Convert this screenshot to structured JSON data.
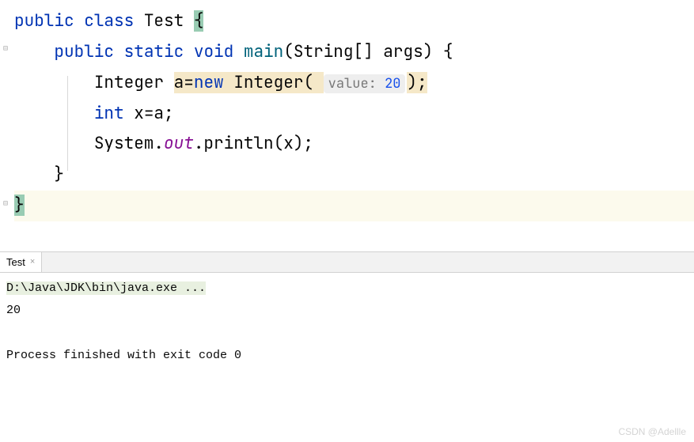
{
  "code": {
    "line1": {
      "kw1": "public",
      "kw2": "class",
      "classname": "Test",
      "brace": "{"
    },
    "line2": {
      "indent": "    ",
      "kw1": "public",
      "kw2": "static",
      "kw3": "void",
      "method": "main",
      "params": "(String[] args) {"
    },
    "line3": {
      "indent": "        ",
      "type": "Integer ",
      "varname": "a",
      "eq": "=",
      "kw_new": "new",
      "ctor": " Integer( ",
      "hint_label": "value:",
      "hint_value": "20",
      "tail": ");"
    },
    "line4": {
      "indent": "        ",
      "kw_int": "int",
      "rest": " x=a;"
    },
    "line5": {
      "indent": "        ",
      "sys": "System.",
      "out": "out",
      "tail": ".println(x);"
    },
    "line6": {
      "indent": "    ",
      "brace": "}"
    },
    "line7": {
      "brace": "}"
    }
  },
  "tab": {
    "name": "Test",
    "close": "×"
  },
  "console": {
    "cmd": "D:\\Java\\JDK\\bin\\java.exe ...",
    "output": "20",
    "exit": "Process finished with exit code 0"
  },
  "watermark": "CSDN @Adellle"
}
